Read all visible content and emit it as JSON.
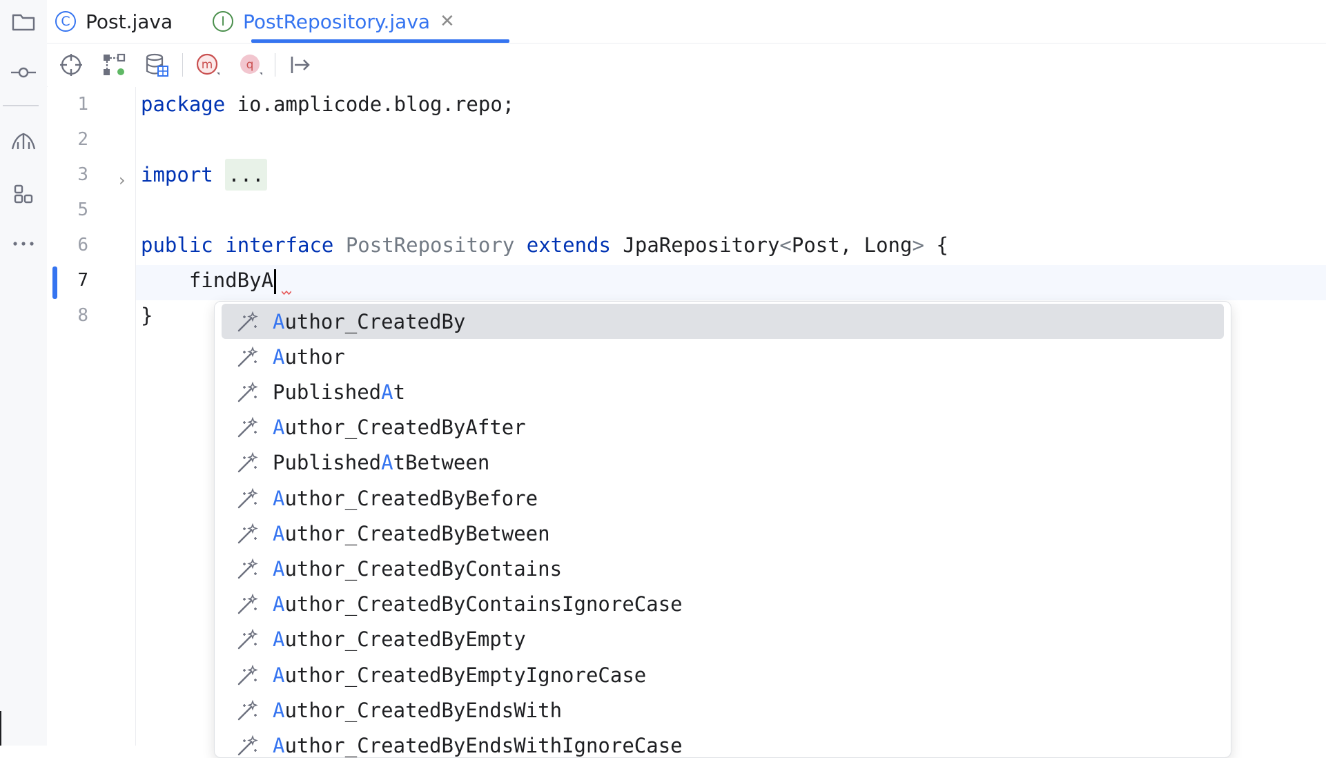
{
  "tabs": [
    {
      "badge": "C",
      "label": "Post.java",
      "active": false
    },
    {
      "badge": "I",
      "label": "PostRepository.java",
      "active": true,
      "close": "✕"
    }
  ],
  "gutter": [
    "1",
    "2",
    "3",
    "5",
    "6",
    "7",
    "8"
  ],
  "code": {
    "line1_kw": "package",
    "line1_rest": " io.amplicode.blog.repo;",
    "line3_kw": "import",
    "line3_fold": "...",
    "line6_kw1": "public",
    "line6_kw2": "interface",
    "line6_name": "PostRepository",
    "line6_kw3": "extends",
    "line6_rest1": " JpaRepository",
    "line6_lt": "<",
    "line6_rest2": "Post, Long",
    "line6_gt": ">",
    "line6_brace": " {",
    "line7_text": "    findByA",
    "line8_text": "}"
  },
  "completion": [
    {
      "pre": "",
      "hl": "A",
      "post": "uthor_CreatedBy",
      "selected": true
    },
    {
      "pre": "",
      "hl": "A",
      "post": "uthor"
    },
    {
      "pre": "Published",
      "hl": "A",
      "post": "t"
    },
    {
      "pre": "",
      "hl": "A",
      "post": "uthor_CreatedByAfter"
    },
    {
      "pre": "Published",
      "hl": "A",
      "post": "tBetween"
    },
    {
      "pre": "",
      "hl": "A",
      "post": "uthor_CreatedByBefore"
    },
    {
      "pre": "",
      "hl": "A",
      "post": "uthor_CreatedByBetween"
    },
    {
      "pre": "",
      "hl": "A",
      "post": "uthor_CreatedByContains"
    },
    {
      "pre": "",
      "hl": "A",
      "post": "uthor_CreatedByContainsIgnoreCase"
    },
    {
      "pre": "",
      "hl": "A",
      "post": "uthor_CreatedByEmpty"
    },
    {
      "pre": "",
      "hl": "A",
      "post": "uthor_CreatedByEmptyIgnoreCase"
    },
    {
      "pre": "",
      "hl": "A",
      "post": "uthor_CreatedByEndsWith"
    },
    {
      "pre": "",
      "hl": "A",
      "post": "uthor_CreatedByEndsWithIgnoreCase"
    }
  ],
  "toolbar_icons": [
    "crosshair-icon",
    "structure-icon",
    "database-icon",
    "method-icon",
    "query-icon",
    "goto-icon"
  ],
  "colors": {
    "accent": "#3574f0",
    "keyword": "#0033b3",
    "selection": "#dfe1e5"
  }
}
